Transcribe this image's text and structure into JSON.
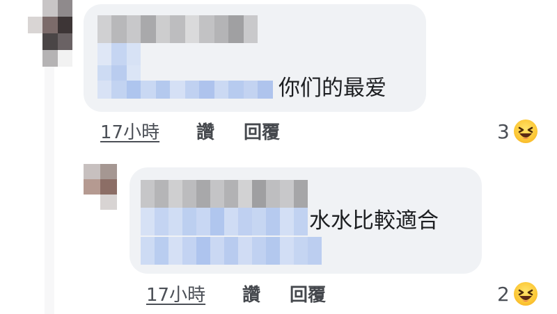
{
  "comments": [
    {
      "text": "你们的最爱",
      "time": "17小時",
      "like_label": "讚",
      "reply_label": "回覆",
      "reaction_count": "3",
      "reaction_icon": "laughing-emoji-icon"
    },
    {
      "text": "水水比較適合",
      "time": "17小時",
      "like_label": "讚",
      "reply_label": "回覆",
      "reaction_count": "2",
      "reaction_icon": "laughing-emoji-icon"
    }
  ],
  "colors": {
    "bubble": "#f0f2f5",
    "blurred_name": "#c4c4c6",
    "blurred_text": "#c6d6f1",
    "meta_text": "#4b4f56",
    "emoji": "#fcc736"
  }
}
